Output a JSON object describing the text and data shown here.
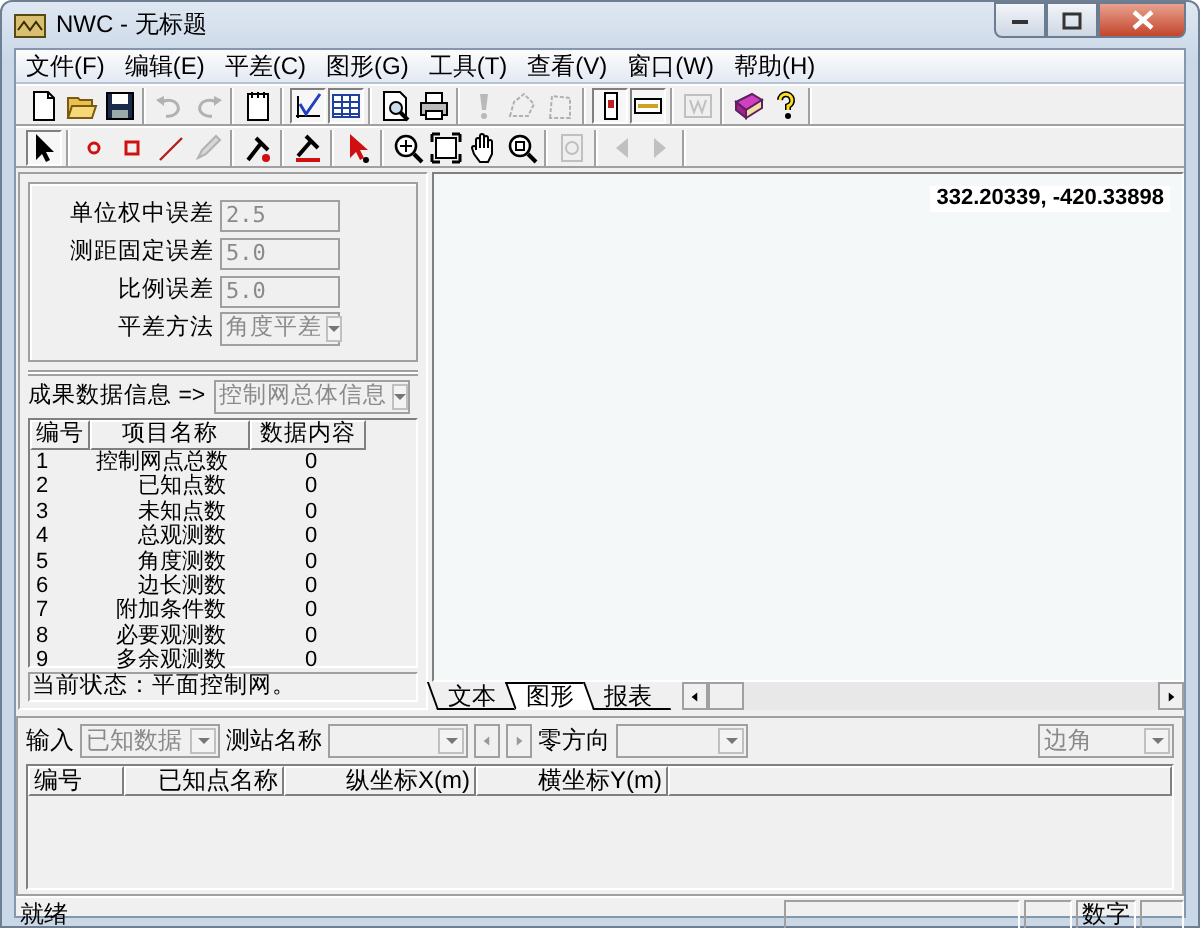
{
  "window": {
    "title": "NWC - 无标题"
  },
  "menu": [
    "文件(F)",
    "编辑(E)",
    "平差(C)",
    "图形(G)",
    "工具(T)",
    "查看(V)",
    "窗口(W)",
    "帮助(H)"
  ],
  "toolbars": [
    [
      [
        {
          "pressed": false,
          "disabled": false
        },
        {
          "pressed": false,
          "disabled": false
        },
        {
          "pressed": false,
          "disabled": false
        }
      ],
      [
        {
          "pressed": false,
          "disabled": true
        },
        {
          "pressed": false,
          "disabled": true
        }
      ],
      [
        {
          "pressed": false,
          "disabled": false
        }
      ],
      [
        {
          "pressed": true,
          "disabled": false
        },
        {
          "pressed": true,
          "disabled": false
        }
      ],
      [
        {
          "pressed": false,
          "disabled": false
        },
        {
          "pressed": false,
          "disabled": false
        }
      ],
      [
        {
          "pressed": false,
          "disabled": true
        },
        {
          "pressed": false,
          "disabled": true
        },
        {
          "pressed": false,
          "disabled": true
        }
      ],
      [
        {
          "pressed": true,
          "disabled": false
        },
        {
          "pressed": true,
          "disabled": false
        }
      ],
      [
        {
          "pressed": false,
          "disabled": true
        }
      ],
      [
        {
          "pressed": false,
          "disabled": false
        },
        {
          "pressed": false,
          "disabled": false
        }
      ]
    ],
    [
      [
        {
          "pressed": true,
          "disabled": false
        }
      ],
      [
        {
          "pressed": false,
          "disabled": false
        },
        {
          "pressed": false,
          "disabled": false
        },
        {
          "pressed": false,
          "disabled": false
        },
        {
          "pressed": false,
          "disabled": true
        }
      ],
      [
        {
          "pressed": false,
          "disabled": false
        }
      ],
      [
        {
          "pressed": false,
          "disabled": false
        }
      ],
      [
        {
          "pressed": false,
          "disabled": false
        }
      ],
      [
        {
          "pressed": false,
          "disabled": false
        },
        {
          "pressed": false,
          "disabled": false
        },
        {
          "pressed": false,
          "disabled": false
        },
        {
          "pressed": false,
          "disabled": false
        }
      ],
      [
        {
          "pressed": false,
          "disabled": true
        }
      ],
      [
        {
          "pressed": false,
          "disabled": true
        },
        {
          "pressed": false,
          "disabled": true
        }
      ]
    ]
  ],
  "parameters": [
    {
      "kind": "input",
      "label": "单位权中误差",
      "value": "2.5",
      "disabled": true
    },
    {
      "kind": "input",
      "label": "测距固定误差",
      "value": "5.0",
      "disabled": true
    },
    {
      "kind": "input",
      "label": "比例误差",
      "value": "5.0",
      "disabled": true
    },
    {
      "kind": "select",
      "label": "平差方法",
      "value": "角度平差",
      "disabled": true
    }
  ],
  "results": {
    "label": "成果数据信息 =>",
    "selector": {
      "value": "控制网总体信息",
      "disabled": true
    },
    "table": {
      "columns": [
        "编号",
        "项目名称",
        "数据内容"
      ],
      "rows": [
        [
          "1",
          "控制网点总数",
          "0"
        ],
        [
          "2",
          "已知点数",
          "0"
        ],
        [
          "3",
          "未知点数",
          "0"
        ],
        [
          "4",
          "总观测数",
          "0"
        ],
        [
          "5",
          "角度测数",
          "0"
        ],
        [
          "6",
          "边长测数",
          "0"
        ],
        [
          "7",
          "附加条件数",
          "0"
        ],
        [
          "8",
          "必要观测数",
          "0"
        ],
        [
          "9",
          "多余观测数",
          "0"
        ]
      ]
    },
    "status": "当前状态：平面控制网。"
  },
  "canvas": {
    "coordinates": "332.20339, -420.33898"
  },
  "tabs": [
    {
      "label": "文本",
      "selected": false
    },
    {
      "label": "图形",
      "selected": true
    },
    {
      "label": "报表",
      "selected": false
    }
  ],
  "input_panel": {
    "label": "输入",
    "input_type": {
      "value": "已知数据",
      "disabled": true
    },
    "station_label": "测站名称",
    "station": {
      "disabled": true
    },
    "zero_direction_label": "零方向",
    "zero_direction": {
      "disabled": true
    },
    "mode": {
      "value": "边角",
      "disabled": true
    },
    "table": {
      "columns": [
        "编号",
        "已知点名称",
        "纵坐标X(m)",
        "横坐标Y(m)"
      ]
    }
  },
  "status_bar": {
    "message": "就绪",
    "num_lock": "数字"
  }
}
